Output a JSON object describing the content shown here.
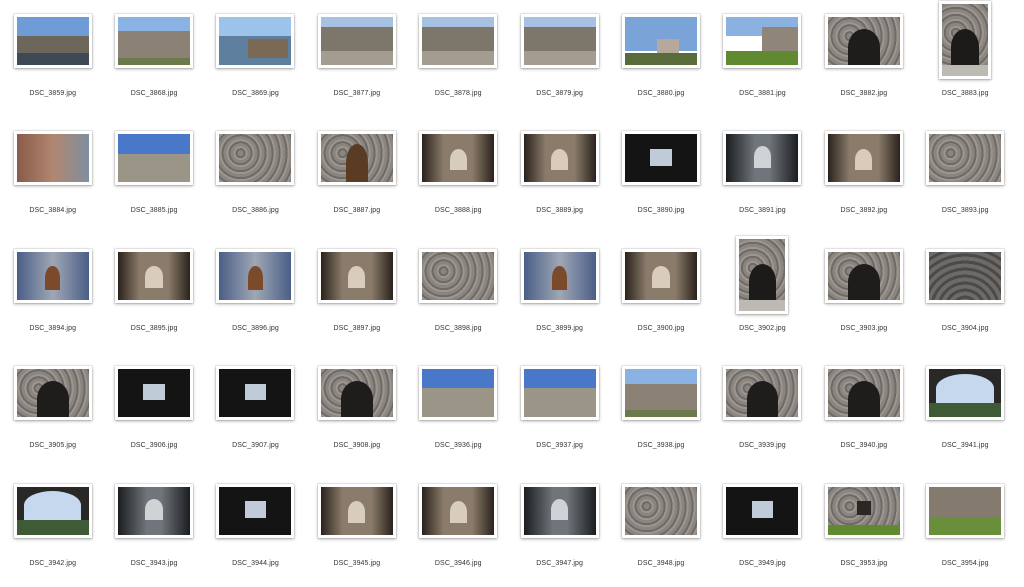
{
  "files": [
    {
      "name": "DSC_3859.jpg",
      "kind": "fortress-water"
    },
    {
      "name": "DSC_3868.jpg",
      "kind": "fortress-wall"
    },
    {
      "name": "DSC_3869.jpg",
      "kind": "dock"
    },
    {
      "name": "DSC_3877.jpg",
      "kind": "path-hill"
    },
    {
      "name": "DSC_3878.jpg",
      "kind": "path-hill"
    },
    {
      "name": "DSC_3879.jpg",
      "kind": "path-hill"
    },
    {
      "name": "DSC_3880.jpg",
      "kind": "trees-house"
    },
    {
      "name": "DSC_3881.jpg",
      "kind": "lawn-house"
    },
    {
      "name": "DSC_3882.jpg",
      "kind": "stone-arch"
    },
    {
      "name": "DSC_3883.jpg",
      "kind": "portrait-arch"
    },
    {
      "name": "DSC_3884.jpg",
      "kind": "brick-wall"
    },
    {
      "name": "DSC_3885.jpg",
      "kind": "sky-wall"
    },
    {
      "name": "DSC_3886.jpg",
      "kind": "stone-texture"
    },
    {
      "name": "DSC_3887.jpg",
      "kind": "wooden-door"
    },
    {
      "name": "DSC_3888.jpg",
      "kind": "tunnel"
    },
    {
      "name": "DSC_3889.jpg",
      "kind": "tunnel"
    },
    {
      "name": "DSC_3890.jpg",
      "kind": "dark-window"
    },
    {
      "name": "DSC_3891.jpg",
      "kind": "dark-arch"
    },
    {
      "name": "DSC_3892.jpg",
      "kind": "tunnel"
    },
    {
      "name": "DSC_3893.jpg",
      "kind": "stone-texture"
    },
    {
      "name": "DSC_3894.jpg",
      "kind": "blue-door"
    },
    {
      "name": "DSC_3895.jpg",
      "kind": "tunnel"
    },
    {
      "name": "DSC_3896.jpg",
      "kind": "blue-door"
    },
    {
      "name": "DSC_3897.jpg",
      "kind": "tunnel"
    },
    {
      "name": "DSC_3898.jpg",
      "kind": "stone-texture"
    },
    {
      "name": "DSC_3899.jpg",
      "kind": "blue-door"
    },
    {
      "name": "DSC_3900.jpg",
      "kind": "tunnel"
    },
    {
      "name": "DSC_3902.jpg",
      "kind": "portrait-arch"
    },
    {
      "name": "DSC_3903.jpg",
      "kind": "stone-arch"
    },
    {
      "name": "DSC_3904.jpg",
      "kind": "cobble"
    },
    {
      "name": "DSC_3905.jpg",
      "kind": "stone-arch"
    },
    {
      "name": "DSC_3906.jpg",
      "kind": "dark-window"
    },
    {
      "name": "DSC_3907.jpg",
      "kind": "dark-window"
    },
    {
      "name": "DSC_3908.jpg",
      "kind": "stone-arch"
    },
    {
      "name": "DSC_3936.jpg",
      "kind": "sky-wall"
    },
    {
      "name": "DSC_3937.jpg",
      "kind": "sky-wall"
    },
    {
      "name": "DSC_3938.jpg",
      "kind": "fortress-wall"
    },
    {
      "name": "DSC_3939.jpg",
      "kind": "stone-arch"
    },
    {
      "name": "DSC_3940.jpg",
      "kind": "stone-arch"
    },
    {
      "name": "DSC_3941.jpg",
      "kind": "arch-view"
    },
    {
      "name": "DSC_3942.jpg",
      "kind": "arch-view"
    },
    {
      "name": "DSC_3943.jpg",
      "kind": "dark-arch"
    },
    {
      "name": "DSC_3944.jpg",
      "kind": "dark-window"
    },
    {
      "name": "DSC_3945.jpg",
      "kind": "tunnel"
    },
    {
      "name": "DSC_3946.jpg",
      "kind": "tunnel"
    },
    {
      "name": "DSC_3947.jpg",
      "kind": "dark-arch"
    },
    {
      "name": "DSC_3948.jpg",
      "kind": "stone-texture"
    },
    {
      "name": "DSC_3949.jpg",
      "kind": "dark-window"
    },
    {
      "name": "DSC_3953.jpg",
      "kind": "lawn-window"
    },
    {
      "name": "DSC_3954.jpg",
      "kind": "lawn-rock"
    }
  ]
}
